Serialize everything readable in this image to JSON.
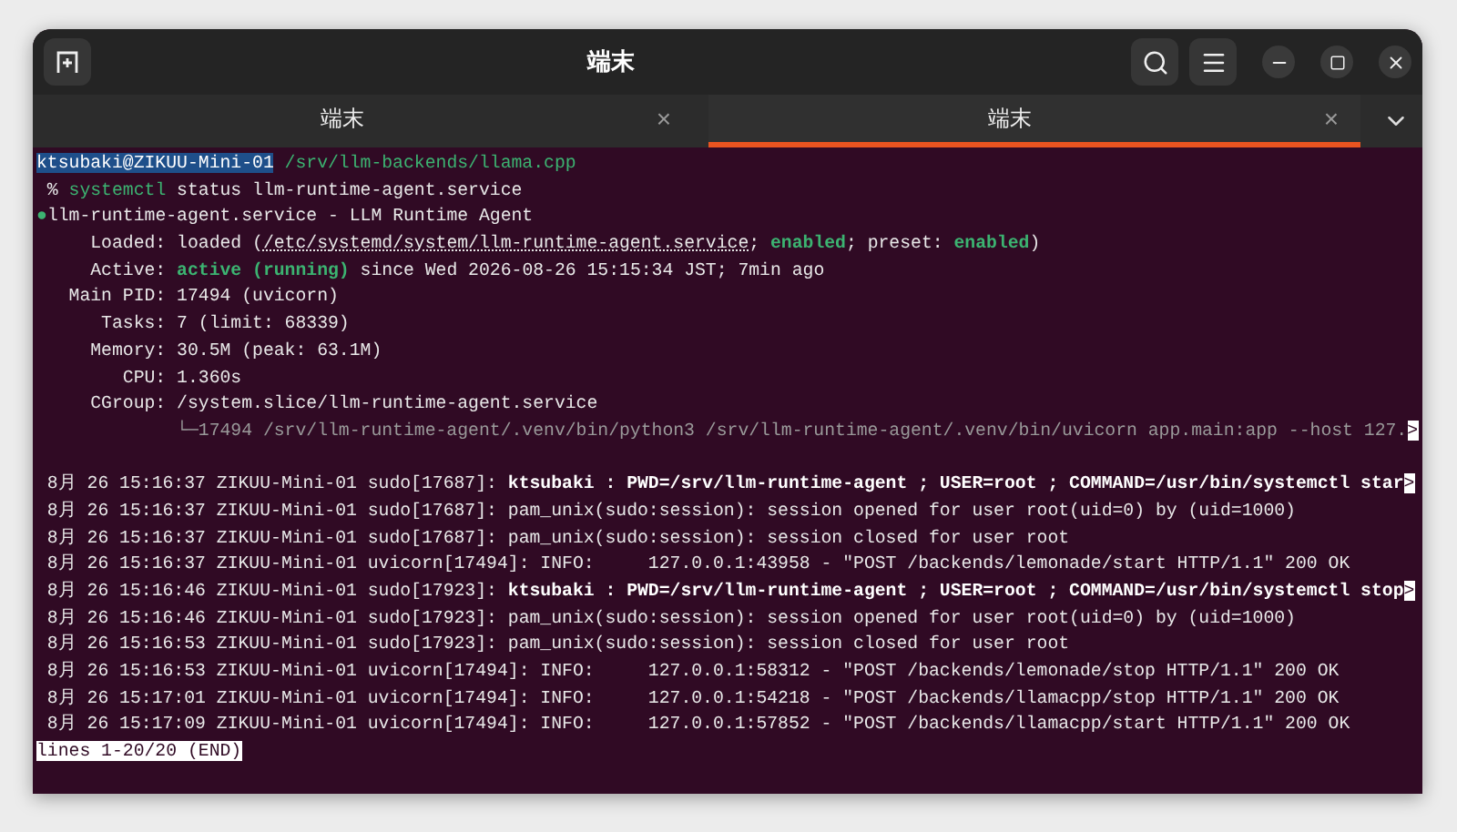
{
  "window": {
    "title": "端末"
  },
  "tabs": [
    {
      "label": "端末",
      "close": "×",
      "selected": false
    },
    {
      "label": "端末",
      "close": "×",
      "selected": true
    }
  ],
  "terminal": {
    "status_lines": [
      [
        {
          "kind": "host",
          "text": "ktsubaki@ZIKUU-Mini-01"
        },
        {
          "kind": "green",
          "text": " /srv/llm-backends/llama.cpp"
        }
      ],
      [
        {
          "kind": "plain",
          "text": " % "
        },
        {
          "kind": "green",
          "text": "systemctl"
        },
        {
          "kind": "plain",
          "text": " status llm-runtime-agent.service"
        }
      ],
      [
        {
          "kind": "green",
          "text": "●"
        },
        {
          "kind": "plain",
          "text": "llm-runtime-agent.service - LLM Runtime Agent"
        }
      ],
      [
        {
          "kind": "plain",
          "text": "     Loaded: loaded ("
        },
        {
          "kind": "link",
          "text": "/etc/systemd/system/llm-runtime-agent.service"
        },
        {
          "kind": "plain",
          "text": "; "
        },
        {
          "kind": "greenbold",
          "text": "enabled"
        },
        {
          "kind": "plain",
          "text": "; preset: "
        },
        {
          "kind": "greenbold",
          "text": "enabled"
        },
        {
          "kind": "plain",
          "text": ")"
        }
      ],
      [
        {
          "kind": "plain",
          "text": "     Active: "
        },
        {
          "kind": "greenbold",
          "text": "active (running)"
        },
        {
          "kind": "plain",
          "text": " since Wed 2026-08-26 15:15:34 JST; 7min ago"
        }
      ],
      [
        {
          "kind": "plain",
          "text": "   Main PID: 17494 (uvicorn)"
        }
      ],
      [
        {
          "kind": "plain",
          "text": "      Tasks: 7 (limit: 68339)"
        }
      ],
      [
        {
          "kind": "plain",
          "text": "     Memory: 30.5M (peak: 63.1M)"
        }
      ],
      [
        {
          "kind": "plain",
          "text": "        CPU: 1.360s"
        }
      ],
      [
        {
          "kind": "plain",
          "text": "     CGroup: /system.slice/llm-runtime-agent.service"
        }
      ],
      [
        {
          "kind": "dim",
          "text": "             └─17494 /srv/llm-runtime-agent/.venv/bin/python3 /srv/llm-runtime-agent/.venv/bin/uvicorn app.main:app --host 127."
        },
        {
          "kind": "more",
          "text": ">"
        }
      ]
    ],
    "journal_lines": [
      [
        {
          "kind": "plain",
          "text": " 8月 26 15:16:37 ZIKUU-Mini-01 sudo[17687]: "
        },
        {
          "kind": "bold",
          "text": "ktsubaki : PWD=/srv/llm-runtime-agent ; USER=root ; COMMAND=/usr/bin/systemctl star"
        },
        {
          "kind": "more",
          "text": ">"
        }
      ],
      [
        {
          "kind": "plain",
          "text": " 8月 26 15:16:37 ZIKUU-Mini-01 sudo[17687]: pam_unix(sudo:session): session opened for user root(uid=0) by (uid=1000)"
        }
      ],
      [
        {
          "kind": "plain",
          "text": " 8月 26 15:16:37 ZIKUU-Mini-01 sudo[17687]: pam_unix(sudo:session): session closed for user root"
        }
      ],
      [
        {
          "kind": "plain",
          "text": " 8月 26 15:16:37 ZIKUU-Mini-01 uvicorn[17494]: INFO:     127.0.0.1:43958 - \"POST /backends/lemonade/start HTTP/1.1\" 200 OK"
        }
      ],
      [
        {
          "kind": "plain",
          "text": " 8月 26 15:16:46 ZIKUU-Mini-01 sudo[17923]: "
        },
        {
          "kind": "bold",
          "text": "ktsubaki : PWD=/srv/llm-runtime-agent ; USER=root ; COMMAND=/usr/bin/systemctl stop"
        },
        {
          "kind": "more",
          "text": ">"
        }
      ],
      [
        {
          "kind": "plain",
          "text": " 8月 26 15:16:46 ZIKUU-Mini-01 sudo[17923]: pam_unix(sudo:session): session opened for user root(uid=0) by (uid=1000)"
        }
      ],
      [
        {
          "kind": "plain",
          "text": " 8月 26 15:16:53 ZIKUU-Mini-01 sudo[17923]: pam_unix(sudo:session): session closed for user root"
        }
      ],
      [
        {
          "kind": "plain",
          "text": " 8月 26 15:16:53 ZIKUU-Mini-01 uvicorn[17494]: INFO:     127.0.0.1:58312 - \"POST /backends/lemonade/stop HTTP/1.1\" 200 OK"
        }
      ],
      [
        {
          "kind": "plain",
          "text": " 8月 26 15:17:01 ZIKUU-Mini-01 uvicorn[17494]: INFO:     127.0.0.1:54218 - \"POST /backends/llamacpp/stop HTTP/1.1\" 200 OK"
        }
      ],
      [
        {
          "kind": "plain",
          "text": " 8月 26 15:17:09 ZIKUU-Mini-01 uvicorn[17494]: INFO:     127.0.0.1:57852 - \"POST /backends/llamacpp/start HTTP/1.1\" 200 OK"
        }
      ],
      [
        {
          "kind": "pager",
          "text": "lines 1-20/20 (END)"
        }
      ]
    ]
  }
}
